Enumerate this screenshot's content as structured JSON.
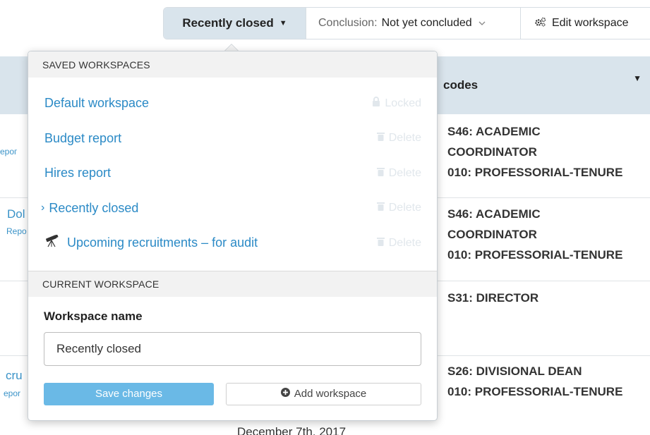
{
  "toolbar": {
    "workspace_label": "Recently closed",
    "conclusion_label": "Conclusion:",
    "conclusion_value": "Not yet concluded",
    "edit_label": "Edit workspace"
  },
  "table": {
    "codes_header": "codes",
    "rows": [
      {
        "codes": [
          "S46: ACADEMIC",
          "COORDINATOR",
          "010: PROFESSORIAL-TENURE"
        ]
      },
      {
        "codes": [
          "S46: ACADEMIC",
          "COORDINATOR",
          "010: PROFESSORIAL-TENURE"
        ]
      },
      {
        "codes": [
          "S31: DIRECTOR"
        ]
      },
      {
        "codes": [
          "S26: DIVISIONAL DEAN",
          "010: PROFESSORIAL-TENURE"
        ]
      }
    ],
    "left_fragments": [
      "ерог",
      "Dol",
      "Repo",
      "cru",
      "еpor"
    ],
    "date_fragment": "December 7th, 2017"
  },
  "dropdown": {
    "saved_header": "SAVED WORKSPACES",
    "workspaces": [
      {
        "name": "Default workspace",
        "action": "Locked",
        "action_icon": "lock-icon"
      },
      {
        "name": "Budget report",
        "action": "Delete",
        "action_icon": "trash-icon"
      },
      {
        "name": "Hires report",
        "action": "Delete",
        "action_icon": "trash-icon"
      },
      {
        "name": "Recently closed",
        "action": "Delete",
        "action_icon": "trash-icon",
        "prefix": "›"
      },
      {
        "name": "Upcoming recruitments – for audit",
        "action": "Delete",
        "action_icon": "trash-icon",
        "prefix_icon": "telescope-icon"
      }
    ],
    "current_header": "CURRENT WORKSPACE",
    "field_label": "Workspace name",
    "field_value": "Recently closed",
    "save_label": "Save changes",
    "add_label": "Add workspace"
  }
}
